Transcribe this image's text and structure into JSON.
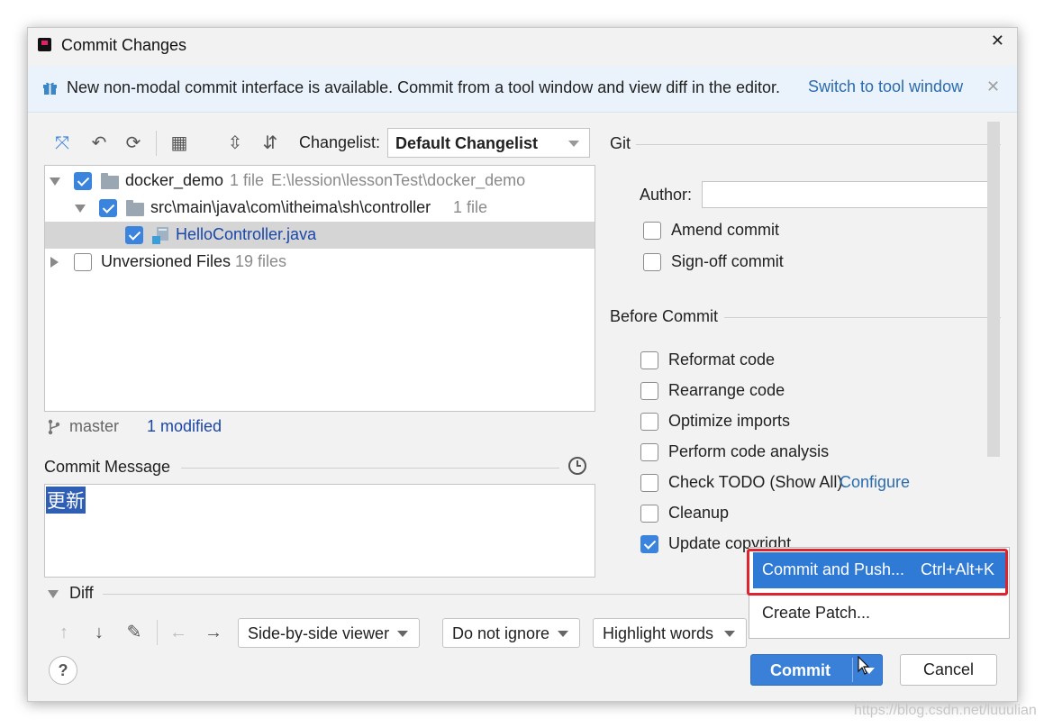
{
  "window": {
    "title": "Commit Changes"
  },
  "banner": {
    "text": "New non-modal commit interface is available. Commit from a tool window and view diff in the editor.",
    "link": "Switch to tool window"
  },
  "toolbar": {
    "changelist_label": "Changelist:",
    "changelist_value": "Default Changelist"
  },
  "tree": {
    "root": {
      "name": "docker_demo",
      "count": "1 file",
      "path": "E:\\lession\\lessonTest\\docker_demo"
    },
    "package": {
      "name": "src\\main\\java\\com\\itheima\\sh\\controller",
      "count": "1 file"
    },
    "file": {
      "name": "HelloController.java"
    },
    "unversioned": {
      "name": "Unversioned Files",
      "count": "19 files"
    }
  },
  "status": {
    "branch": "master",
    "modified": "1 modified"
  },
  "commit_message": {
    "label": "Commit Message",
    "text": "更新"
  },
  "git": {
    "section": "Git",
    "author_label": "Author:",
    "author_value": "",
    "amend": "Amend commit",
    "signoff": "Sign-off commit"
  },
  "before_commit": {
    "section": "Before Commit",
    "options": [
      {
        "label": "Reformat code",
        "checked": false
      },
      {
        "label": "Rearrange code",
        "checked": false
      },
      {
        "label": "Optimize imports",
        "checked": false
      },
      {
        "label": "Perform code analysis",
        "checked": false
      },
      {
        "label": "Check TODO (Show All)",
        "checked": false
      },
      {
        "label": "Cleanup",
        "checked": false
      },
      {
        "label": "Update copyright",
        "checked": true
      }
    ],
    "configure_link": "Configure"
  },
  "diff": {
    "section": "Diff",
    "viewer": "Side-by-side viewer",
    "ignore": "Do not ignore",
    "highlight": "Highlight words"
  },
  "popup": {
    "commit_push": "Commit and Push...",
    "commit_push_shortcut": "Ctrl+Alt+K",
    "create_patch": "Create Patch..."
  },
  "buttons": {
    "help": "?",
    "commit": "Commit",
    "cancel": "Cancel"
  },
  "watermark": "https://blog.csdn.net/luuulian",
  "colors": {
    "accent": "#3a7fd8",
    "link": "#2b6bb0",
    "highlight_box": "#e0242f",
    "banner_bg": "#eaf3fb"
  }
}
